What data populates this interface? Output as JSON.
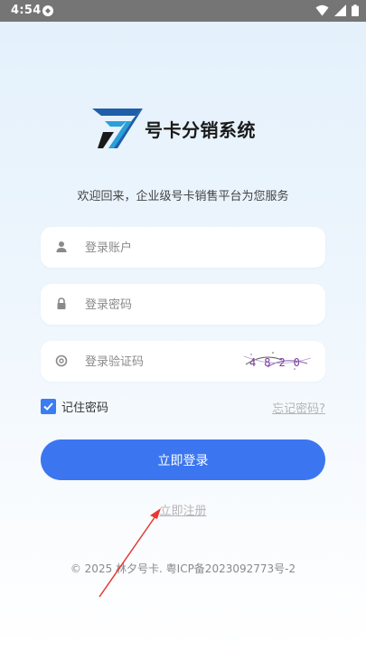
{
  "status_bar": {
    "time": "4:54",
    "icons": [
      "sync-icon",
      "wifi-icon",
      "signal-icon",
      "battery-icon"
    ]
  },
  "logo": {
    "text": "号卡分销系统",
    "mark_colors": [
      "#1f5fa8",
      "#2a9fd8",
      "#1a1a1a"
    ]
  },
  "welcome": "欢迎回来，企业级号卡销售平台为您服务",
  "form": {
    "account_placeholder": "登录账户",
    "password_placeholder": "登录密码",
    "captcha_placeholder": "登录验证码",
    "captcha_code": "4820",
    "remember_label": "记住密码",
    "remember_checked": true,
    "forgot_label": "忘记密码?",
    "login_label": "立即登录",
    "register_label": "立即注册"
  },
  "footer": "© 2025 林夕号卡. 粤ICP备2023092773号-2",
  "colors": {
    "accent": "#3b76f0",
    "muted_link": "#b5b5b5",
    "annotation_arrow": "#e53935"
  }
}
